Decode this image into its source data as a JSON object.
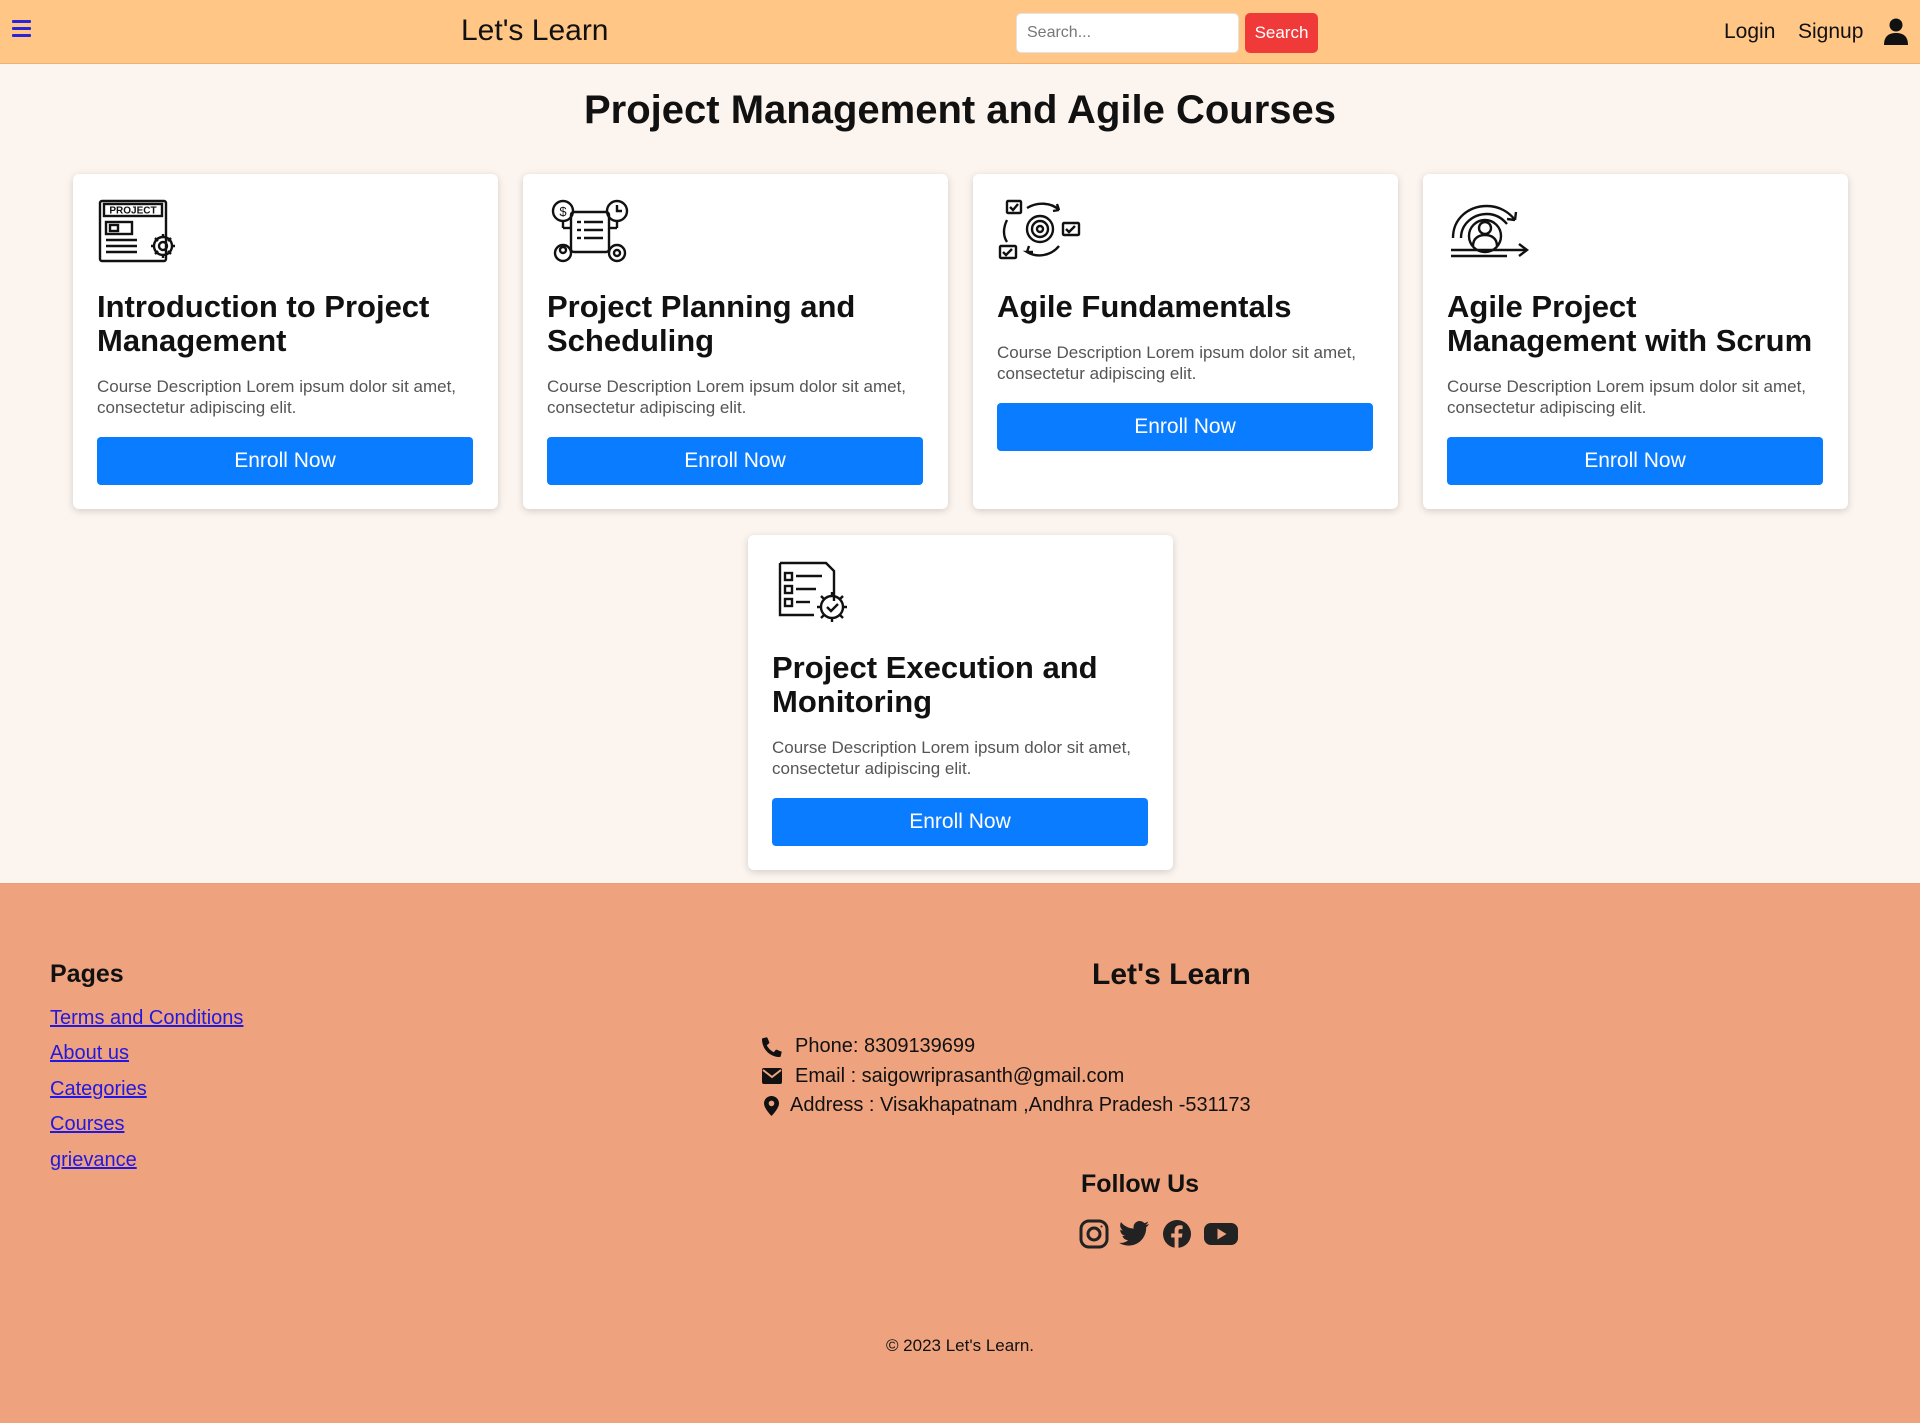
{
  "navbar": {
    "brand": "Let's Learn",
    "search_placeholder": "Search...",
    "search_button": "Search",
    "login": "Login",
    "signup": "Signup"
  },
  "page_title": "Project Management and Agile Courses",
  "courses": [
    {
      "title": "Introduction to Project Management",
      "description": "Course Description Lorem ipsum dolor sit amet, consectetur adipiscing elit.",
      "button": "Enroll Now",
      "icon": "project-document-icon"
    },
    {
      "title": "Project Planning and Scheduling",
      "description": "Course Description Lorem ipsum dolor sit amet, consectetur adipiscing elit.",
      "button": "Enroll Now",
      "icon": "planning-schedule-icon"
    },
    {
      "title": "Agile Fundamentals",
      "description": "Course Description Lorem ipsum dolor sit amet, consectetur adipiscing elit.",
      "button": "Enroll Now",
      "icon": "agile-cycle-icon"
    },
    {
      "title": "Agile Project Management with Scrum",
      "description": "Course Description Lorem ipsum dolor sit amet, consectetur adipiscing elit.",
      "button": "Enroll Now",
      "icon": "scrum-team-icon"
    },
    {
      "title": "Project Execution and Monitoring",
      "description": "Course Description Lorem ipsum dolor sit amet, consectetur adipiscing elit.",
      "button": "Enroll Now",
      "icon": "checklist-gear-icon"
    }
  ],
  "footer": {
    "pages_title": "Pages",
    "links": [
      "Terms and Conditions",
      "About us",
      "Categories",
      "Courses",
      "grievance"
    ],
    "brand": "Let's Learn",
    "phone": "Phone: 8309139699",
    "email": "Email : saigowriprasanth@gmail.com",
    "address": "Address : Visakhapatnam ,Andhra Pradesh -531173",
    "follow_title": "Follow Us",
    "social": [
      "instagram-icon",
      "twitter-icon",
      "facebook-icon",
      "youtube-icon"
    ],
    "copyright": "© 2023 Let's Learn."
  },
  "colors": {
    "navbar": "#ffc685",
    "page_background": "#fcf4ee",
    "search_button": "#f03a3a",
    "enroll_button": "#0a7cff",
    "footer": "#eea37e",
    "link": "#2318e0"
  }
}
